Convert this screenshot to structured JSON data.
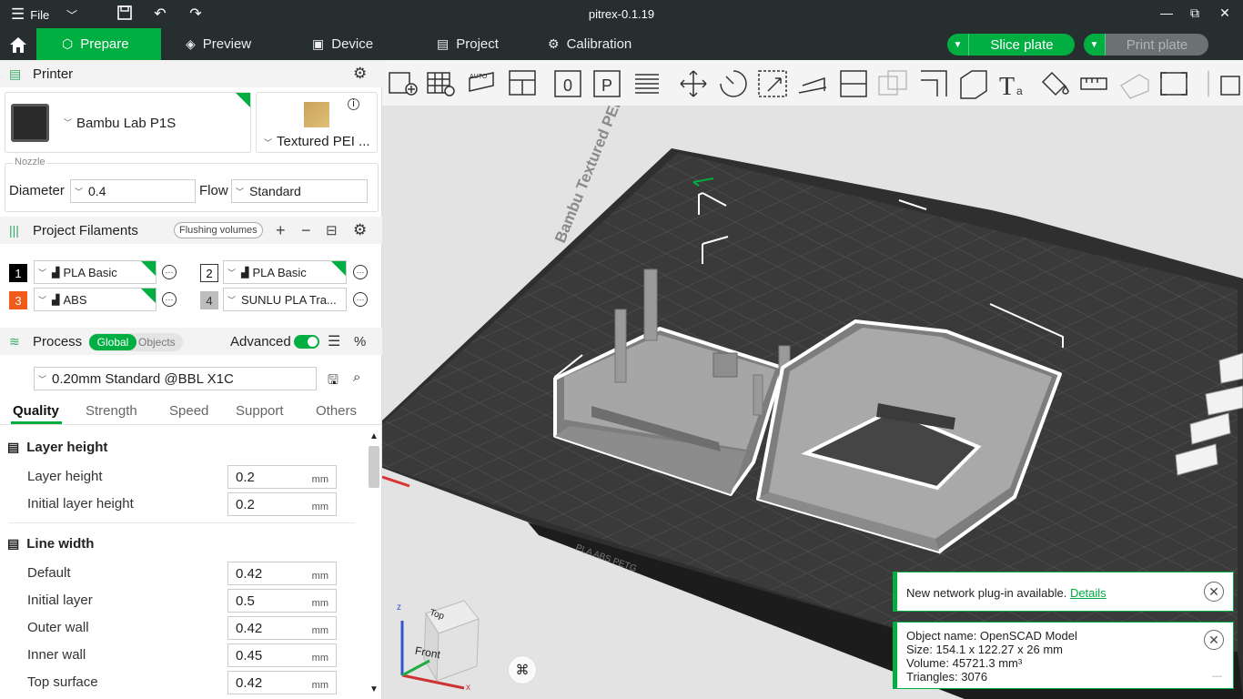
{
  "app": {
    "title": "pitrex-0.1.19",
    "file_menu": "File"
  },
  "nav": {
    "tabs": [
      {
        "label": "Prepare",
        "icon": "cube-icon"
      },
      {
        "label": "Preview",
        "icon": "layers-icon"
      },
      {
        "label": "Device",
        "icon": "device-icon"
      },
      {
        "label": "Project",
        "icon": "project-icon"
      },
      {
        "label": "Calibration",
        "icon": "calibration-icon"
      }
    ],
    "slice_label": "Slice plate",
    "print_label": "Print plate"
  },
  "printer": {
    "section_label": "Printer",
    "name": "Bambu Lab P1S",
    "plate": "Textured PEI ...",
    "nozzle_label": "Nozzle",
    "diameter_label": "Diameter",
    "diameter_value": "0.4",
    "flow_label": "Flow",
    "flow_value": "Standard"
  },
  "filaments": {
    "section_label": "Project Filaments",
    "flushing_label": "Flushing volumes",
    "items": [
      {
        "num": "1",
        "name": "PLA Basic",
        "color": "#000000"
      },
      {
        "num": "2",
        "name": "PLA Basic",
        "color": "#ffffff"
      },
      {
        "num": "3",
        "name": "ABS",
        "color": "#f05a1a"
      },
      {
        "num": "4",
        "name": "SUNLU PLA Tra...",
        "color": "#bdbdbd"
      }
    ]
  },
  "process": {
    "section_label": "Process",
    "global_label": "Global",
    "objects_label": "Objects",
    "advanced_label": "Advanced",
    "profile": "0.20mm Standard @BBL X1C",
    "tabs": [
      "Quality",
      "Strength",
      "Speed",
      "Support",
      "Others"
    ],
    "groups": [
      {
        "title": "Layer height",
        "rows": [
          {
            "label": "Layer height",
            "value": "0.2",
            "unit": "mm"
          },
          {
            "label": "Initial layer height",
            "value": "0.2",
            "unit": "mm"
          }
        ]
      },
      {
        "title": "Line width",
        "rows": [
          {
            "label": "Default",
            "value": "0.42",
            "unit": "mm"
          },
          {
            "label": "Initial layer",
            "value": "0.5",
            "unit": "mm"
          },
          {
            "label": "Outer wall",
            "value": "0.42",
            "unit": "mm"
          },
          {
            "label": "Inner wall",
            "value": "0.45",
            "unit": "mm"
          },
          {
            "label": "Top surface",
            "value": "0.42",
            "unit": "mm"
          }
        ]
      }
    ]
  },
  "plate": {
    "brand_text": "Bambu Textured PEI Plate",
    "bottom_text": "PLA ABS PETG"
  },
  "notifications": {
    "plugin_text": "New network plug-in available.",
    "plugin_link": "Details",
    "object_name": "Object name: OpenSCAD Model",
    "object_size": "Size: 154.1 x 122.27 x 26 mm",
    "object_volume": "Volume: 45721.3 mm³",
    "object_triangles": "Triangles: 3076"
  },
  "viewcube": {
    "top": "Top",
    "front": "Front",
    "axis_x": "x",
    "axis_z": "z"
  },
  "colors": {
    "accent": "#00ae42",
    "dark": "#262e30"
  }
}
